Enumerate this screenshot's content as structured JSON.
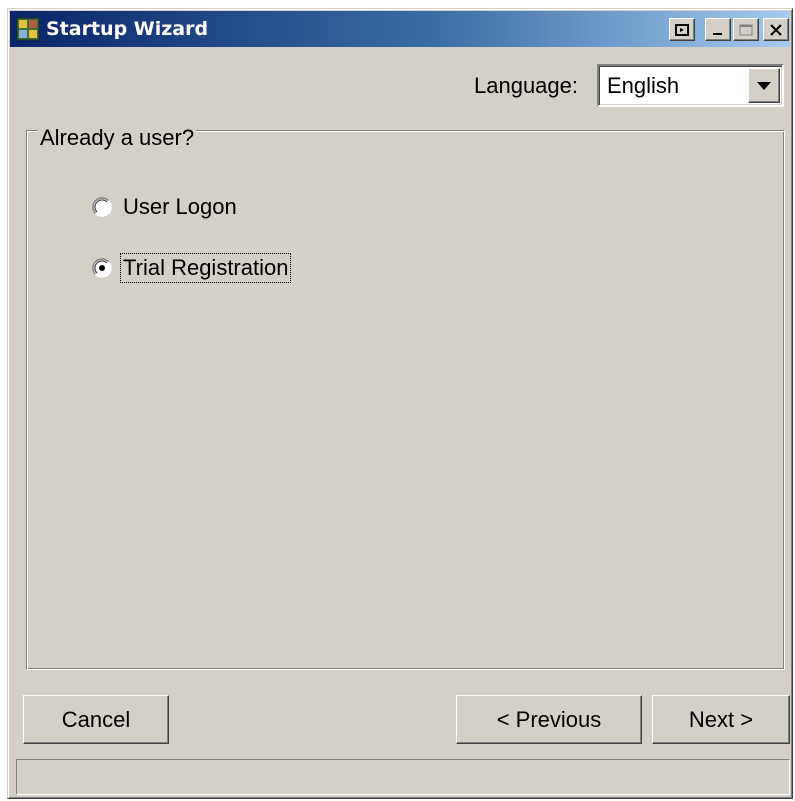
{
  "window": {
    "title": "Startup Wizard",
    "title_bar_colors": [
      "#0a246a",
      "#a6caf0"
    ],
    "controls": {
      "float_icon": "float-window-icon",
      "minimize_icon": "minimize-icon",
      "maximize_icon": "maximize-icon",
      "close_icon": "close-icon"
    }
  },
  "language": {
    "label": "Language:",
    "selected": "English"
  },
  "group": {
    "title": "Already a user?",
    "options": [
      {
        "label": "User Logon",
        "selected": false
      },
      {
        "label": "Trial Registration",
        "selected": true
      }
    ]
  },
  "buttons": {
    "cancel": "Cancel",
    "previous": "< Previous",
    "next": "Next >"
  },
  "status_bar": {
    "text": ""
  }
}
